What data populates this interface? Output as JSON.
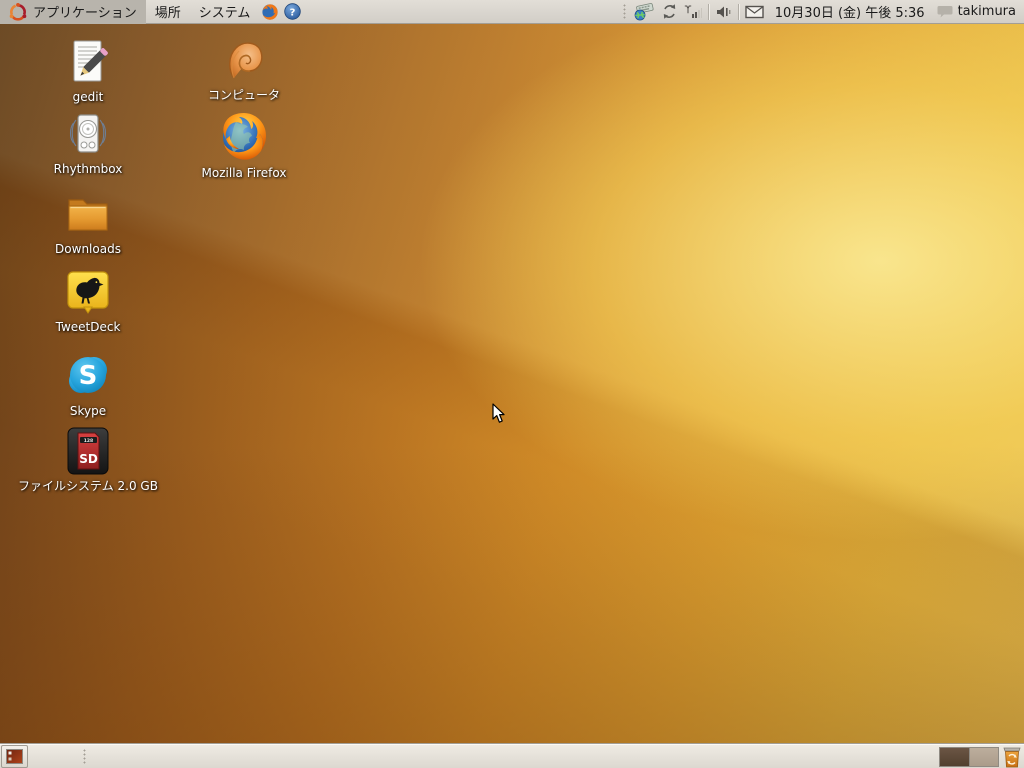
{
  "top_panel": {
    "menus": [
      {
        "label": "アプリケーション"
      },
      {
        "label": "場所"
      },
      {
        "label": "システム"
      }
    ],
    "clock": "10月30日 (金) 午後 5:36",
    "user": "takimura"
  },
  "desktop": {
    "icons": [
      {
        "label": "gedit"
      },
      {
        "label": "コンピュータ"
      },
      {
        "label": "Rhythmbox"
      },
      {
        "label": "Mozilla Firefox"
      },
      {
        "label": "Downloads"
      },
      {
        "label": "TweetDeck"
      },
      {
        "label": "Skype"
      },
      {
        "label": "ファイルシステム 2.0 GB",
        "card_capacity": "128",
        "card_text": "SD"
      }
    ]
  },
  "bottom_panel": {
    "workspace_count": 2,
    "active_workspace_index": 0
  },
  "colors": {
    "panel_bg": "#d8d4cd",
    "ubuntu_orange": "#dd4814",
    "wallpaper_dark": "#5b3716",
    "wallpaper_bright": "#f8e488",
    "active_workspace": "#52402f",
    "inactive_workspace": "#b3a492"
  }
}
